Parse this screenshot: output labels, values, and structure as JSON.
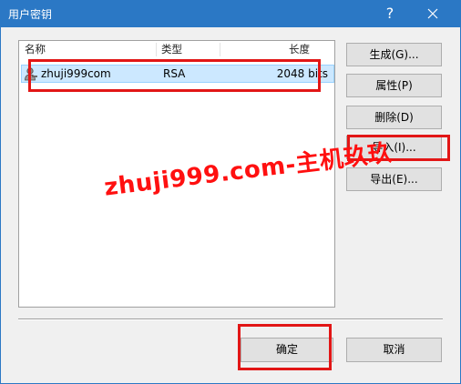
{
  "window": {
    "title": "用户密钥",
    "help_glyph": "?",
    "close_glyph": "✕"
  },
  "list": {
    "columns": [
      "名称",
      "类型",
      "长度"
    ],
    "rows": [
      {
        "name": "zhuji999com",
        "type": "RSA",
        "length": "2048 bits",
        "icon": "key-user-icon"
      }
    ]
  },
  "buttons": {
    "generate": "生成(G)...",
    "properties": "属性(P)",
    "delete": "删除(D)",
    "import": "导入(I)...",
    "export": "导出(E)...",
    "ok": "确定",
    "cancel": "取消"
  },
  "watermark": "zhuji999.com-主机玖玖",
  "colors": {
    "titlebar": "#2b78c5",
    "selection": "#cce8ff",
    "highlight_box": "#e21616"
  }
}
